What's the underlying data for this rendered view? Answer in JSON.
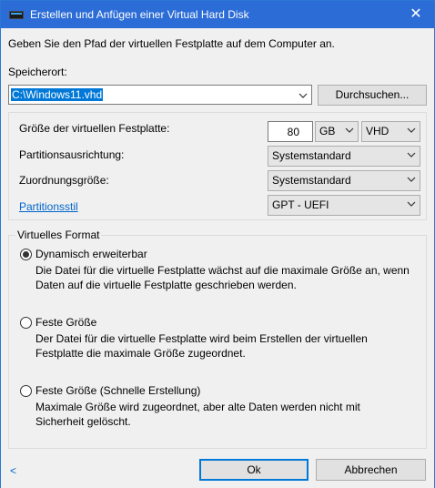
{
  "window": {
    "title": "Erstellen und Anfügen einer Virtual Hard Disk",
    "close_glyph": "✕"
  },
  "intro": "Geben Sie den Pfad der virtuellen Festplatte auf dem Computer an.",
  "location": {
    "label": "Speicherort:",
    "value": "C:\\Windows11.vhd",
    "browse_label": "Durchsuchen..."
  },
  "size": {
    "label": "Größe der virtuellen Festplatte:",
    "value": "80",
    "unit": "GB",
    "type": "VHD"
  },
  "alignment": {
    "label": "Partitionsausrichtung:",
    "value": "Systemstandard"
  },
  "allocation": {
    "label": "Zuordnungsgröße:",
    "value": "Systemstandard"
  },
  "partition_style": {
    "label": "Partitionsstil",
    "value": "GPT - UEFI"
  },
  "format": {
    "group_label": "Virtuelles Format",
    "selected": "dynamic",
    "options": [
      {
        "id": "dynamic",
        "label": "Dynamisch erweiterbar",
        "description": "Die Datei für die virtuelle Festplatte wächst auf die maximale Größe an, wenn Daten auf die virtuelle Festplatte geschrieben werden."
      },
      {
        "id": "fixed",
        "label": "Feste Größe",
        "description": "Der Datei für die virtuelle Festplatte wird beim Erstellen der virtuellen Festplatte die maximale Größe zugeordnet."
      },
      {
        "id": "fixed-fast",
        "label": "Feste Größe (Schnelle Erstellung)",
        "description": "Maximale Größe wird zugeordnet, aber alte Daten werden nicht mit Sicherheit gelöscht."
      }
    ]
  },
  "footer": {
    "back_glyph": "<",
    "ok_label": "Ok",
    "cancel_label": "Abbrechen"
  },
  "colors": {
    "titlebar": "#2b6cd6",
    "link": "#0066cc",
    "selection": "#0078d7"
  },
  "icons": {
    "title": "virtual-disk-icon",
    "dropdown": "chevron-down-icon",
    "close": "close-icon"
  }
}
